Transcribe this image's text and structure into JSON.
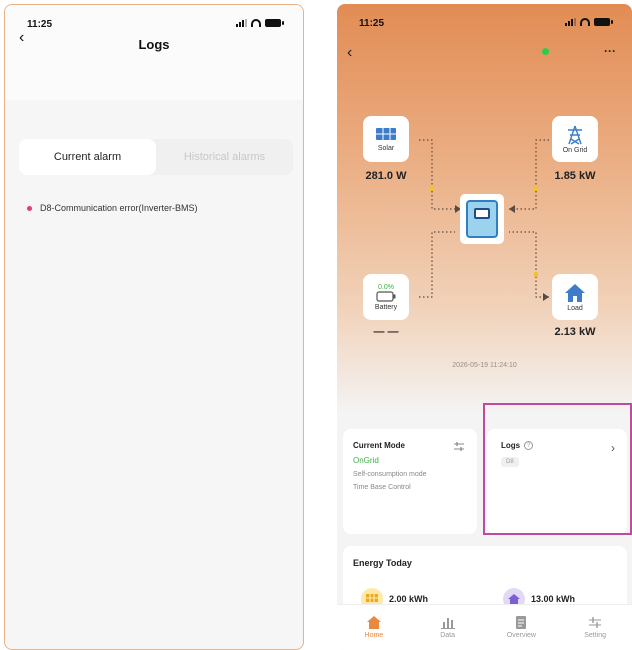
{
  "left_screen": {
    "status": {
      "time": "11:25"
    },
    "title": "Logs",
    "tabs": [
      {
        "label": "Current alarm",
        "active": true
      },
      {
        "label": "Historical alarms",
        "active": false
      }
    ],
    "alarms": [
      {
        "text": "D8-Communication error(Inverter-BMS)",
        "color": "#e0406a"
      }
    ]
  },
  "right_screen": {
    "status": {
      "time": "11:25"
    },
    "nodes": {
      "solar": {
        "label": "Solar",
        "value": "281.0 W"
      },
      "grid": {
        "label": "On Grid",
        "value": "1.85 kW"
      },
      "battery": {
        "label": "Battery",
        "percent": "0.0%",
        "value": "— —"
      },
      "load": {
        "label": "Load",
        "value": "2.13 kW"
      }
    },
    "timestamp": "2026-05-19 11:24:10",
    "current_mode": {
      "title": "Current Mode",
      "mode": "OnGrid",
      "line1": "Self-consumption mode",
      "line2": "Time Base Control"
    },
    "logs": {
      "title": "Logs",
      "help": "?",
      "badge": "D8"
    },
    "energy_today": {
      "title": "Energy Today",
      "items": [
        {
          "value": "2.00 kWh",
          "icon": "solar-icon"
        },
        {
          "value": "13.00 kWh",
          "icon": "home-icon"
        }
      ]
    },
    "nav": [
      {
        "label": "Home",
        "icon": "home-icon",
        "active": true
      },
      {
        "label": "Data",
        "icon": "bar-chart-icon",
        "active": false
      },
      {
        "label": "Overview",
        "icon": "document-icon",
        "active": false
      },
      {
        "label": "Setting",
        "icon": "sliders-icon",
        "active": false
      }
    ],
    "colors": {
      "accent": "#e8893f",
      "online": "#2ecc4a",
      "highlight": "#c04aa0"
    }
  }
}
